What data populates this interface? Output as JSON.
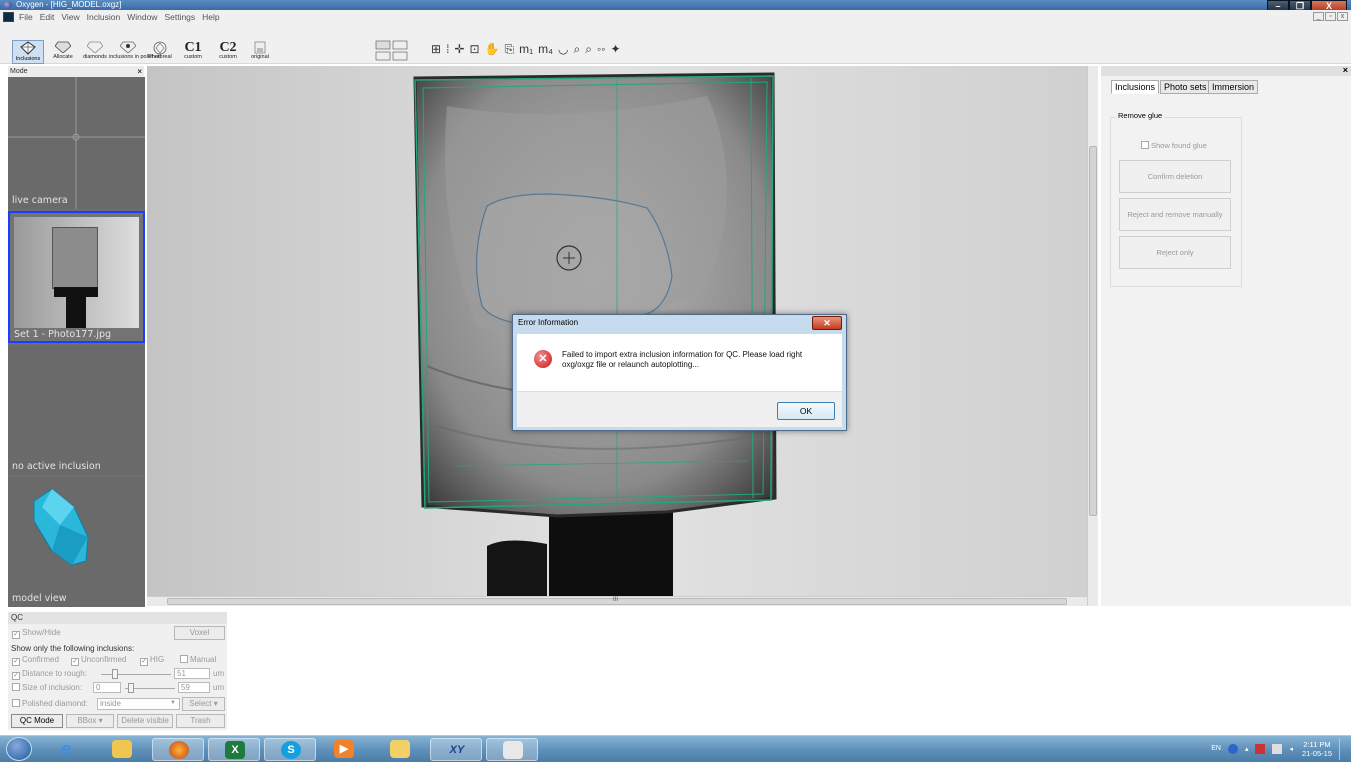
{
  "window": {
    "title": "Oxygen - [HIG_MODEL.oxgz]",
    "buttons": [
      "–",
      "❐",
      "X"
    ],
    "mdi_buttons": [
      "_",
      "▫",
      "x"
    ]
  },
  "menu": [
    "File",
    "Edit",
    "View",
    "Inclusion",
    "Window",
    "Settings",
    "Help"
  ],
  "toolbar": {
    "buttons": [
      {
        "label": "Inclusions"
      },
      {
        "label": "Allocate"
      },
      {
        "label": "diamonds"
      },
      {
        "label": "inclusions in polished"
      },
      {
        "label": "Photoreal"
      },
      {
        "big": "C1",
        "label": "custom"
      },
      {
        "big": "C2",
        "label": "custom"
      },
      {
        "label": "original"
      }
    ],
    "tools": [
      "⊞",
      "⁞",
      "✛",
      "⊡",
      "✋",
      "⎘",
      "m₁",
      "m₄",
      "◡",
      "⌕",
      "⌕",
      "◦◦",
      "✦"
    ]
  },
  "left_panel": {
    "header": "Mode",
    "tiles": [
      {
        "label": "live camera"
      },
      {
        "label": "Set 1 - Photo177.jpg"
      },
      {
        "label": "no active inclusion"
      },
      {
        "label": "model view"
      }
    ]
  },
  "canvas": {
    "hscroll_marker": "III"
  },
  "right_panel": {
    "tabs": [
      "Inclusions",
      "Photo sets",
      "Immersion"
    ],
    "group_title": "Remove glue",
    "checkbox": "Show found glue",
    "buttons": [
      "Confirm deletion",
      "Reject and remove manually",
      "Reject only"
    ]
  },
  "qc": {
    "header": "QC",
    "show_hide": "Show/Hide",
    "voxel": "Voxel",
    "filter_title": "Show only the following inclusions:",
    "confirmed": "Confirmed",
    "unconfirmed": "Unconfirmed",
    "hig": "HIG",
    "manual": "Manual",
    "distance_label": "Distance to rough:",
    "distance_value": "51",
    "size_label": "Size of inclusion:",
    "size_min": "0",
    "size_max": "59",
    "unit": "um",
    "polished_label": "Polished diamond:",
    "polished_value": "inside",
    "select_label": "Select",
    "qc_mode": "QC Mode",
    "bbox": "BBox",
    "delete_visible": "Delete visible",
    "trash": "Trash"
  },
  "dialog": {
    "title": "Error Information",
    "message": "Failed to import extra inclusion information for QC. Please load right oxg/oxgz file or relaunch autoplotting...",
    "ok": "OK"
  },
  "taskbar": {
    "apps": [
      "start",
      "internet-explorer",
      "file-explorer",
      "firefox",
      "excel",
      "skype",
      "media",
      "folder",
      "oxygen",
      "paint"
    ],
    "lang": "EN",
    "time": "2:11 PM",
    "date": "21-05-15"
  }
}
